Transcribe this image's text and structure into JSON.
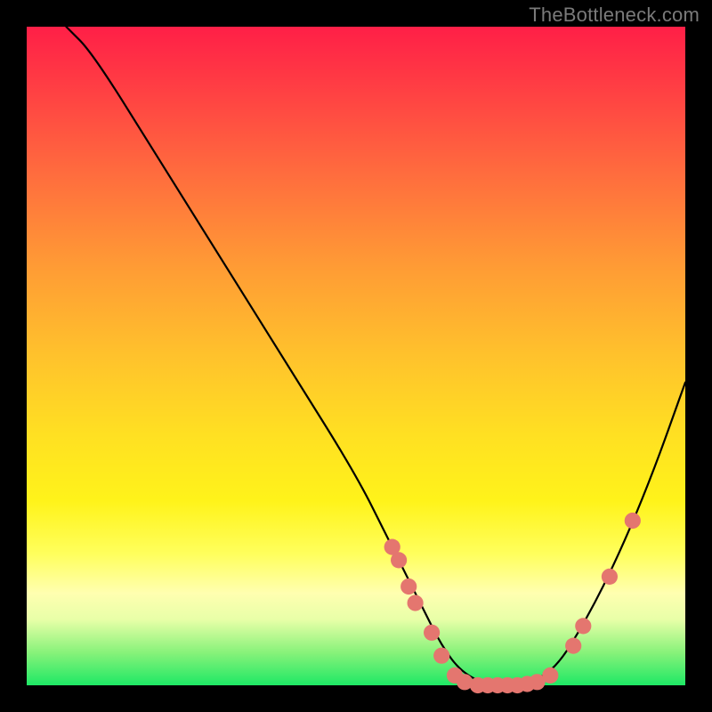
{
  "watermark": "TheBottleneck.com",
  "colors": {
    "background": "#000000",
    "gradient_top": "#ff1f47",
    "gradient_mid": "#ffe022",
    "gradient_bottom": "#1ee865",
    "curve": "#000000",
    "markers": "#e4766f"
  },
  "chart_data": {
    "type": "line",
    "title": "",
    "xlabel": "",
    "ylabel": "",
    "xlim": [
      0,
      100
    ],
    "ylim": [
      0,
      100
    ],
    "legend": false,
    "grid": false,
    "series": [
      {
        "name": "curve",
        "x": [
          6,
          10,
          20,
          30,
          40,
          50,
          55,
          60,
          63,
          66,
          70,
          75,
          80,
          85,
          90,
          95,
          100
        ],
        "y": [
          100,
          96,
          80,
          64,
          48,
          32,
          22,
          12,
          6,
          2,
          0,
          0,
          2,
          10,
          20,
          32,
          46
        ]
      }
    ],
    "markers": [
      {
        "x": 55.5,
        "y": 21.0,
        "r": 1.1
      },
      {
        "x": 56.5,
        "y": 19.0,
        "r": 1.1
      },
      {
        "x": 58.0,
        "y": 15.0,
        "r": 1.1
      },
      {
        "x": 59.0,
        "y": 12.5,
        "r": 1.1
      },
      {
        "x": 61.5,
        "y": 8.0,
        "r": 1.1
      },
      {
        "x": 63.0,
        "y": 4.5,
        "r": 1.1
      },
      {
        "x": 65.0,
        "y": 1.5,
        "r": 1.1
      },
      {
        "x": 66.5,
        "y": 0.5,
        "r": 1.1
      },
      {
        "x": 68.5,
        "y": 0.0,
        "r": 1.1
      },
      {
        "x": 70.0,
        "y": 0.0,
        "r": 1.1
      },
      {
        "x": 71.5,
        "y": 0.0,
        "r": 1.1
      },
      {
        "x": 73.0,
        "y": 0.0,
        "r": 1.1
      },
      {
        "x": 74.5,
        "y": 0.0,
        "r": 1.1
      },
      {
        "x": 76.0,
        "y": 0.2,
        "r": 1.1
      },
      {
        "x": 77.5,
        "y": 0.5,
        "r": 1.1
      },
      {
        "x": 79.5,
        "y": 1.5,
        "r": 1.1
      },
      {
        "x": 83.0,
        "y": 6.0,
        "r": 1.1
      },
      {
        "x": 84.5,
        "y": 9.0,
        "r": 1.1
      },
      {
        "x": 88.5,
        "y": 16.5,
        "r": 1.1
      },
      {
        "x": 92.0,
        "y": 25.0,
        "r": 1.1
      }
    ]
  }
}
